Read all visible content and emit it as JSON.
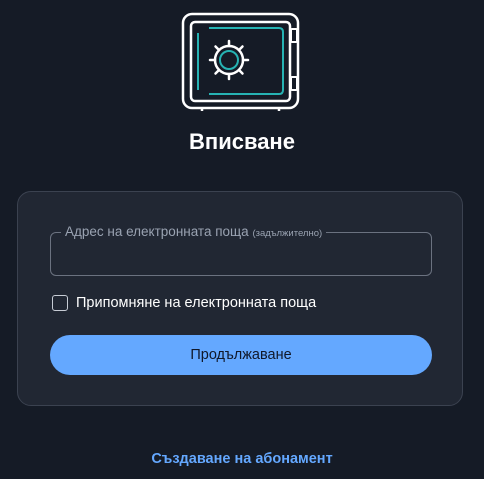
{
  "page": {
    "title": "Вписване"
  },
  "logo": {
    "icon": "vault-safe-icon"
  },
  "form": {
    "email_label": "Адрес на електронната поща",
    "email_hint": "(задължително)",
    "email_value": "",
    "remember_label": "Припомняне на електронната поща",
    "remember_checked": false,
    "continue_label": "Продължаване"
  },
  "footer": {
    "signup_link": "Създаване на абонамент"
  },
  "colors": {
    "background": "#151b26",
    "card": "#212733",
    "accent": "#64a8ff"
  }
}
